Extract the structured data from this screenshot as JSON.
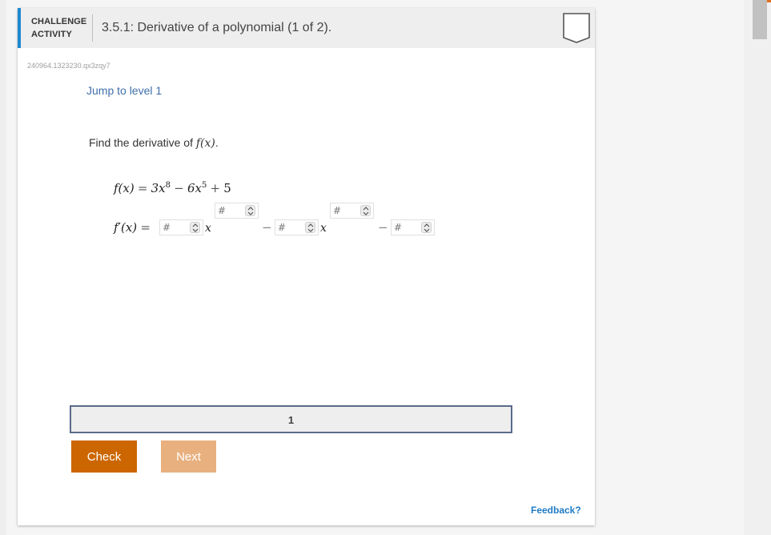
{
  "header": {
    "label_line1": "CHALLENGE",
    "label_line2": "ACTIVITY",
    "title": "3.5.1: Derivative of a polynomial (1 of 2).",
    "status_icon": "completion-box-icon"
  },
  "activity_id": "240964.1323230.qx3zqy7",
  "jump_link": "Jump to level 1",
  "prompt": {
    "text": "Find the derivative of",
    "math": "f(x)",
    "period": "."
  },
  "equation": {
    "lhs": "f(x)",
    "eq": "=",
    "t1_coef": "3x",
    "t1_exp": "8",
    "op1": "−",
    "t2_coef": "6x",
    "t2_exp": "5",
    "op2": "+",
    "const": "5"
  },
  "answer": {
    "lhs_f": "f",
    "lhs_prime": "′",
    "lhs_arg": "(x)",
    "eq": "=",
    "var": "x",
    "minus": "−",
    "placeholder": "#"
  },
  "progress": {
    "level": "1"
  },
  "buttons": {
    "check": "Check",
    "next": "Next"
  },
  "feedback": "Feedback?",
  "colors": {
    "accent_blue": "#1e88d1",
    "check": "#cc6600",
    "next_disabled": "#e8b07e",
    "link": "#3f6fa8",
    "feedback": "#1f7bc6"
  }
}
